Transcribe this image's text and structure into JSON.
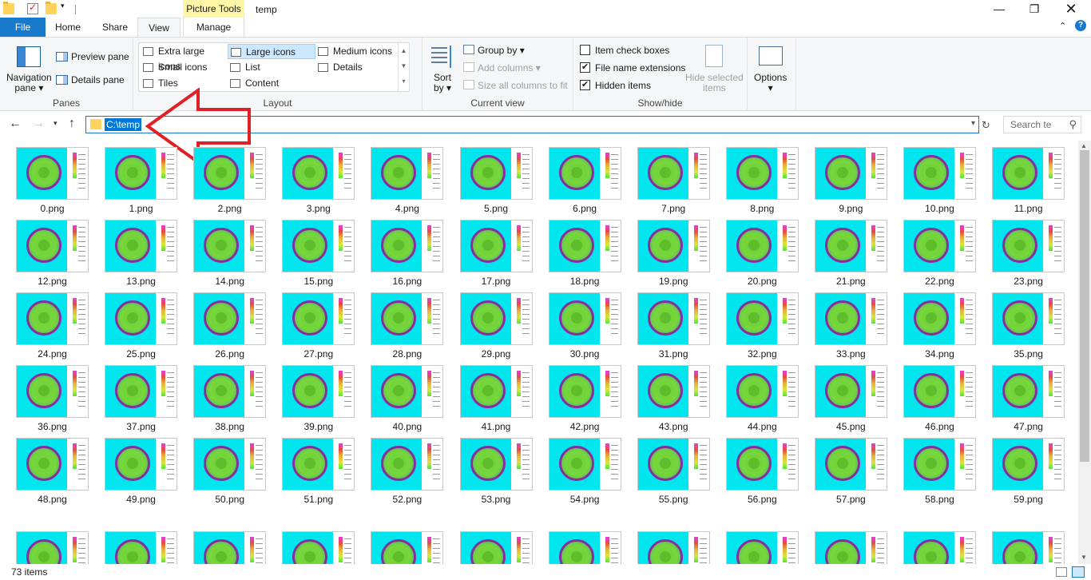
{
  "window": {
    "title": "temp",
    "context_tab": "Picture Tools",
    "controls": {
      "minimize": "—",
      "maximize": "❐",
      "close": "✕"
    }
  },
  "ribbon_tabs": {
    "file": "File",
    "home": "Home",
    "share": "Share",
    "view": "View",
    "manage": "Manage",
    "active": "View"
  },
  "ribbon": {
    "panes": {
      "group_label": "Panes",
      "navigation_pane": "Navigation\npane ▾",
      "preview_pane": "Preview pane",
      "details_pane": "Details pane"
    },
    "layout": {
      "group_label": "Layout",
      "extra_large_icons": "Extra large icons",
      "large_icons": "Large icons",
      "medium_icons": "Medium icons",
      "small_icons": "Small icons",
      "list": "List",
      "details": "Details",
      "tiles": "Tiles",
      "content": "Content",
      "selected": "Large icons"
    },
    "current_view": {
      "group_label": "Current view",
      "sort_by": "Sort\nby ▾",
      "group_by": "Group by ▾",
      "add_columns": "Add columns ▾",
      "size_all_columns": "Size all columns to fit"
    },
    "show_hide": {
      "group_label": "Show/hide",
      "item_check_boxes": {
        "label": "Item check boxes",
        "checked": false
      },
      "file_name_extensions": {
        "label": "File name extensions",
        "checked": true
      },
      "hidden_items": {
        "label": "Hidden items",
        "checked": true
      },
      "hide_selected_items": "Hide selected\nitems"
    },
    "options": {
      "label": "Options\n▾"
    }
  },
  "address_bar": {
    "path": "C:\\temp",
    "search_placeholder": "Search te"
  },
  "files": [
    "0.png",
    "1.png",
    "2.png",
    "3.png",
    "4.png",
    "5.png",
    "6.png",
    "7.png",
    "8.png",
    "9.png",
    "10.png",
    "11.png",
    "12.png",
    "13.png",
    "14.png",
    "15.png",
    "16.png",
    "17.png",
    "18.png",
    "19.png",
    "20.png",
    "21.png",
    "22.png",
    "23.png",
    "24.png",
    "25.png",
    "26.png",
    "27.png",
    "28.png",
    "29.png",
    "30.png",
    "31.png",
    "32.png",
    "33.png",
    "34.png",
    "35.png",
    "36.png",
    "37.png",
    "38.png",
    "39.png",
    "40.png",
    "41.png",
    "42.png",
    "43.png",
    "44.png",
    "45.png",
    "46.png",
    "47.png",
    "48.png",
    "49.png",
    "50.png",
    "51.png",
    "52.png",
    "53.png",
    "54.png",
    "55.png",
    "56.png",
    "57.png",
    "58.png",
    "59.png",
    "",
    "",
    "",
    "",
    "",
    "",
    "",
    "",
    "",
    "",
    "",
    ""
  ],
  "status_bar": {
    "item_count": "73 items"
  },
  "colors": {
    "file_tab": "#1979ca",
    "context_tab": "#fef6a6",
    "selection": "#0078d7",
    "annotation_arrow": "#e21f26",
    "thumbnail_bg": "#00e5ee"
  }
}
